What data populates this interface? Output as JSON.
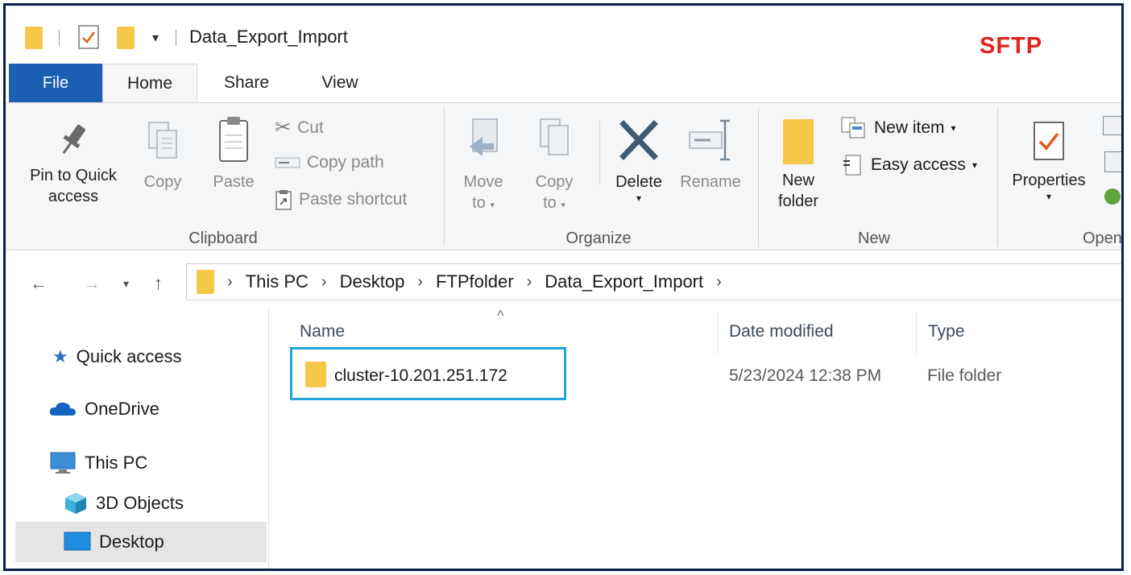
{
  "window": {
    "title": "Data_Export_Import",
    "overlay_label": "SFTP",
    "overlay_color": "#e0231c"
  },
  "ribbon_tabs": [
    {
      "label": "File"
    },
    {
      "label": "Home"
    },
    {
      "label": "Share"
    },
    {
      "label": "View"
    }
  ],
  "ribbon": {
    "clipboard": {
      "pin": "Pin to Quick access",
      "copy": "Copy",
      "paste": "Paste",
      "cut": "Cut",
      "copy_path": "Copy path",
      "paste_shortcut": "Paste shortcut",
      "label": "Clipboard"
    },
    "organize": {
      "move_to_1": "Move",
      "move_to_2": "to",
      "copy_to_1": "Copy",
      "copy_to_2": "to",
      "delete": "Delete",
      "rename": "Rename",
      "label": "Organize"
    },
    "new": {
      "new_folder_1": "New",
      "new_folder_2": "folder",
      "new_item": "New item",
      "easy_access": "Easy access",
      "label": "New"
    },
    "open": {
      "properties": "Properties",
      "label": "Open"
    }
  },
  "address": {
    "crumbs": [
      "This PC",
      "Desktop",
      "FTPfolder",
      "Data_Export_Import"
    ]
  },
  "nav_pane": {
    "quick_access": "Quick access",
    "onedrive": "OneDrive",
    "this_pc": "This PC",
    "objects_3d": "3D Objects",
    "desktop": "Desktop"
  },
  "file_list": {
    "columns": [
      "Name",
      "Date modified",
      "Type"
    ],
    "rows": [
      {
        "name": "cluster-10.201.251.172",
        "date": "5/23/2024 12:38 PM",
        "type": "File folder"
      }
    ],
    "highlight_color": "#22a4d8"
  },
  "colors": {
    "file_tab": "#1a5fb4",
    "folder": "#f5c84a"
  }
}
